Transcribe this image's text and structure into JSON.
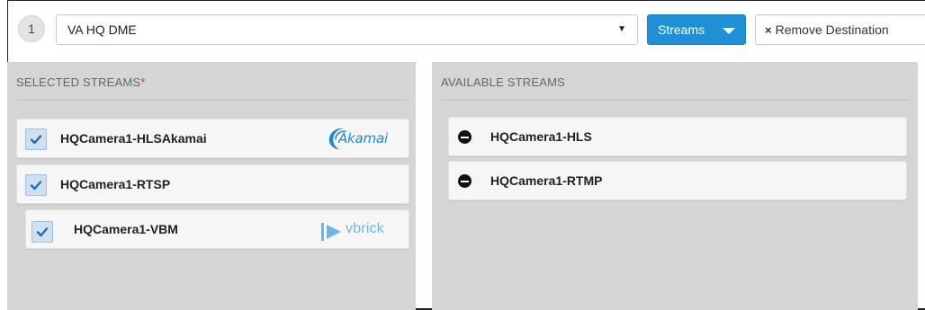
{
  "header": {
    "index": "1",
    "destination_value": "VA HQ DME",
    "streams_button": "Streams",
    "remove_button": "Remove Destination",
    "remove_icon": "×"
  },
  "selected_panel": {
    "title": "SELECTED STREAMS",
    "required_mark": "*",
    "items": [
      {
        "name": "HQCamera1-HLSAkamai",
        "checked": true,
        "logo": "Akamai"
      },
      {
        "name": "HQCamera1-RTSP",
        "checked": true,
        "logo": ""
      },
      {
        "name": "HQCamera1-VBM",
        "checked": true,
        "logo": "vbrick"
      }
    ]
  },
  "available_panel": {
    "title": "AVAILABLE STREAMS",
    "items": [
      {
        "name": "HQCamera1-HLS",
        "icon": "minus-circle-icon"
      },
      {
        "name": "HQCamera1-RTMP",
        "icon": "minus-circle-icon"
      }
    ]
  },
  "colors": {
    "accent": "#1e90d8",
    "required": "#d43c32",
    "panel_bg": "#d5d5d5",
    "checkbox_bg": "#cfe0f3",
    "check": "#1f6fb8"
  }
}
